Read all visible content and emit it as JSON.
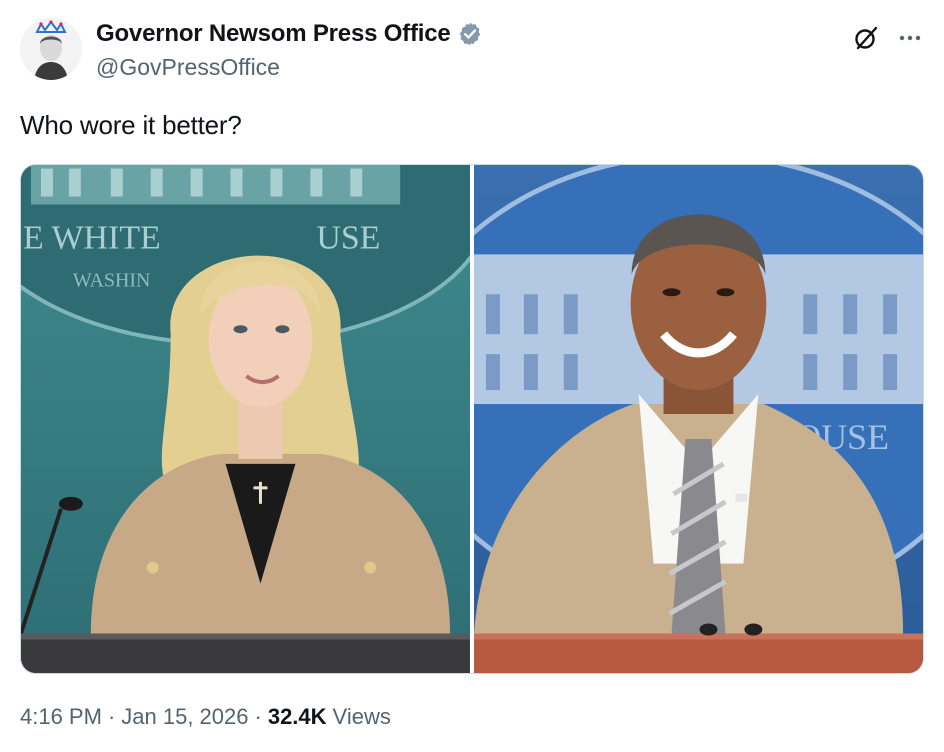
{
  "author": {
    "display_name": "Governor Newsom Press Office",
    "handle": "@GovPressOffice",
    "verified_color": "#829aab"
  },
  "icons": {
    "avatar": "avatar-crown-portrait",
    "verified": "verified-badge-icon",
    "grok": "grok-icon",
    "more": "more-icon"
  },
  "tweet": {
    "text": "Who wore it better?"
  },
  "media": {
    "left_photo": {
      "description_icon": "photo-woman-tan-suit",
      "seal_text_top": "E WHITE",
      "seal_text_top_right": "USE",
      "seal_text_bottom": "WASHIN"
    },
    "right_photo": {
      "description_icon": "photo-man-tan-suit",
      "backdrop_text": "OUSE"
    }
  },
  "meta": {
    "time": "4:16 PM",
    "separator": "·",
    "date": "Jan 15, 2026",
    "views_count": "32.4K",
    "views_label": "Views"
  }
}
